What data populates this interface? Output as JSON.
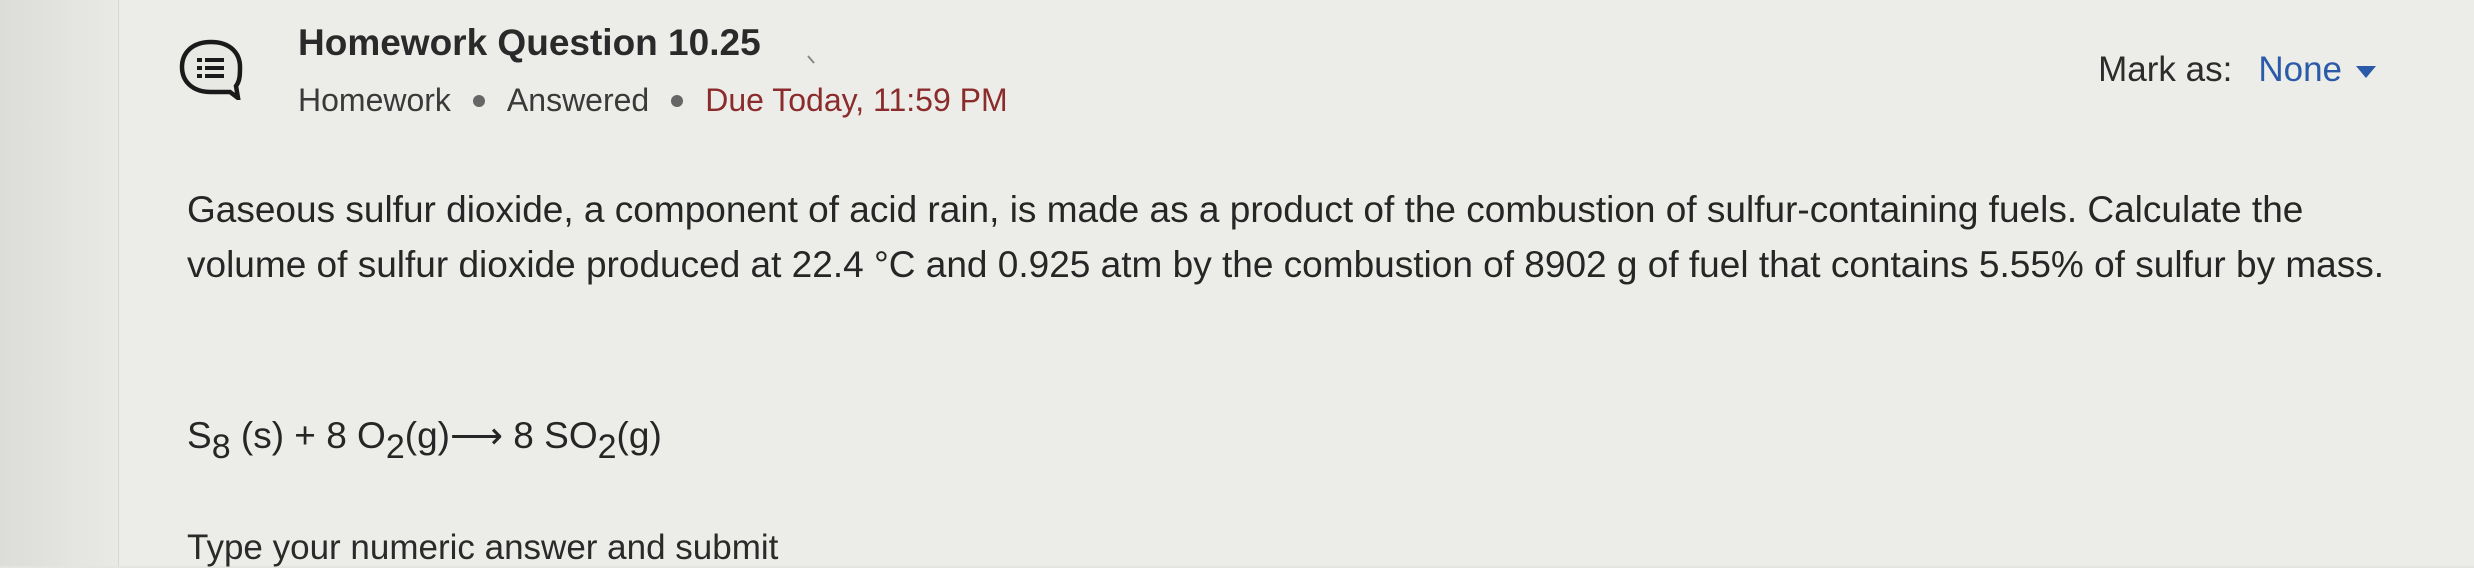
{
  "header": {
    "title": "Homework Question 10.25",
    "meta": {
      "type": "Homework",
      "status": "Answered",
      "due": "Due Today, 11:59 PM"
    },
    "mark_as": {
      "label": "Mark as:",
      "value": "None"
    }
  },
  "question": {
    "text": "Gaseous sulfur dioxide, a component of acid rain, is made as a product of the combustion of sulfur-containing fuels. Calculate the volume of sulfur dioxide produced at 22.4 °C and 0.925 atm by the combustion of 8902 g of fuel that contains 5.55% of sulfur by mass.",
    "equation": {
      "s8": "S",
      "s8_sub": "8",
      "s8_state": " (s) + 8 O",
      "o2_sub": "2",
      "arrow_part": "(g)⟶ 8 SO",
      "so2_sub": "2",
      "end": "(g)"
    }
  },
  "answer": {
    "prompt": "Type your numeric answer and submit"
  },
  "icons": {
    "type_icon": "discussion-bubble-icon"
  }
}
